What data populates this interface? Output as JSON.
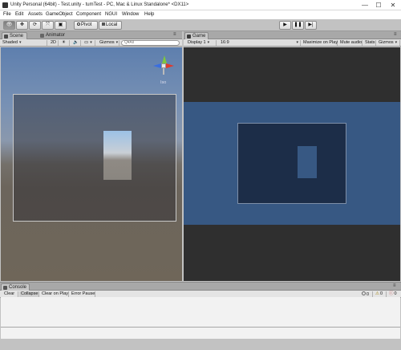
{
  "window": {
    "title": "Unity Personal (64bit) - Test.unity - tumTest - PC, Mac & Linux Standalone* <DX11>",
    "minimize_glyph": "—",
    "maximize_glyph": "☐",
    "close_glyph": "✕"
  },
  "menu": [
    "File",
    "Edit",
    "Assets",
    "GameObject",
    "Component",
    "NGUI",
    "Window",
    "Help"
  ],
  "toolbar": {
    "tools": [
      {
        "name": "hand-tool-icon",
        "glyph": "👁"
      },
      {
        "name": "move-tool-icon",
        "glyph": "✥"
      },
      {
        "name": "rotate-tool-icon",
        "glyph": "⟳"
      },
      {
        "name": "scale-tool-icon",
        "glyph": "⤧"
      },
      {
        "name": "rect-tool-icon",
        "glyph": "▣"
      }
    ],
    "pivot_label": "Pivot",
    "local_label": "Local",
    "play_glyph": "▶",
    "pause_glyph": "❚❚",
    "step_glyph": "▶|"
  },
  "scene_panel": {
    "tabs": [
      "Scene",
      "Animator"
    ],
    "shading": "Shaded",
    "mode_2d": "2D",
    "gizmos": "Gizmos",
    "search_placeholder": "Q▾All",
    "persp_label": "Iso",
    "gizmo_labels": {
      "y": "y",
      "x": "x",
      "z": "z"
    }
  },
  "game_panel": {
    "tab": "Game",
    "display": "Display 1",
    "aspect": "16:9",
    "maximize_on_play": "Maximize on Play",
    "mute_audio": "Mute audio",
    "stats": "Stats",
    "gizmos": "Gizmos"
  },
  "console_panel": {
    "tab": "Console",
    "buttons": [
      "Clear",
      "Collapse",
      "Clear on Play",
      "Error Pause"
    ],
    "counts": {
      "info": "0",
      "warnings": "0",
      "errors": "0"
    }
  },
  "colors": {
    "game_background": "#2f2f2f",
    "game_band": "#375883",
    "game_frame": "#1c2d48",
    "game_inner": "#375883",
    "scene_sky": "#5e7fae",
    "scene_ground": "#6c655c"
  }
}
